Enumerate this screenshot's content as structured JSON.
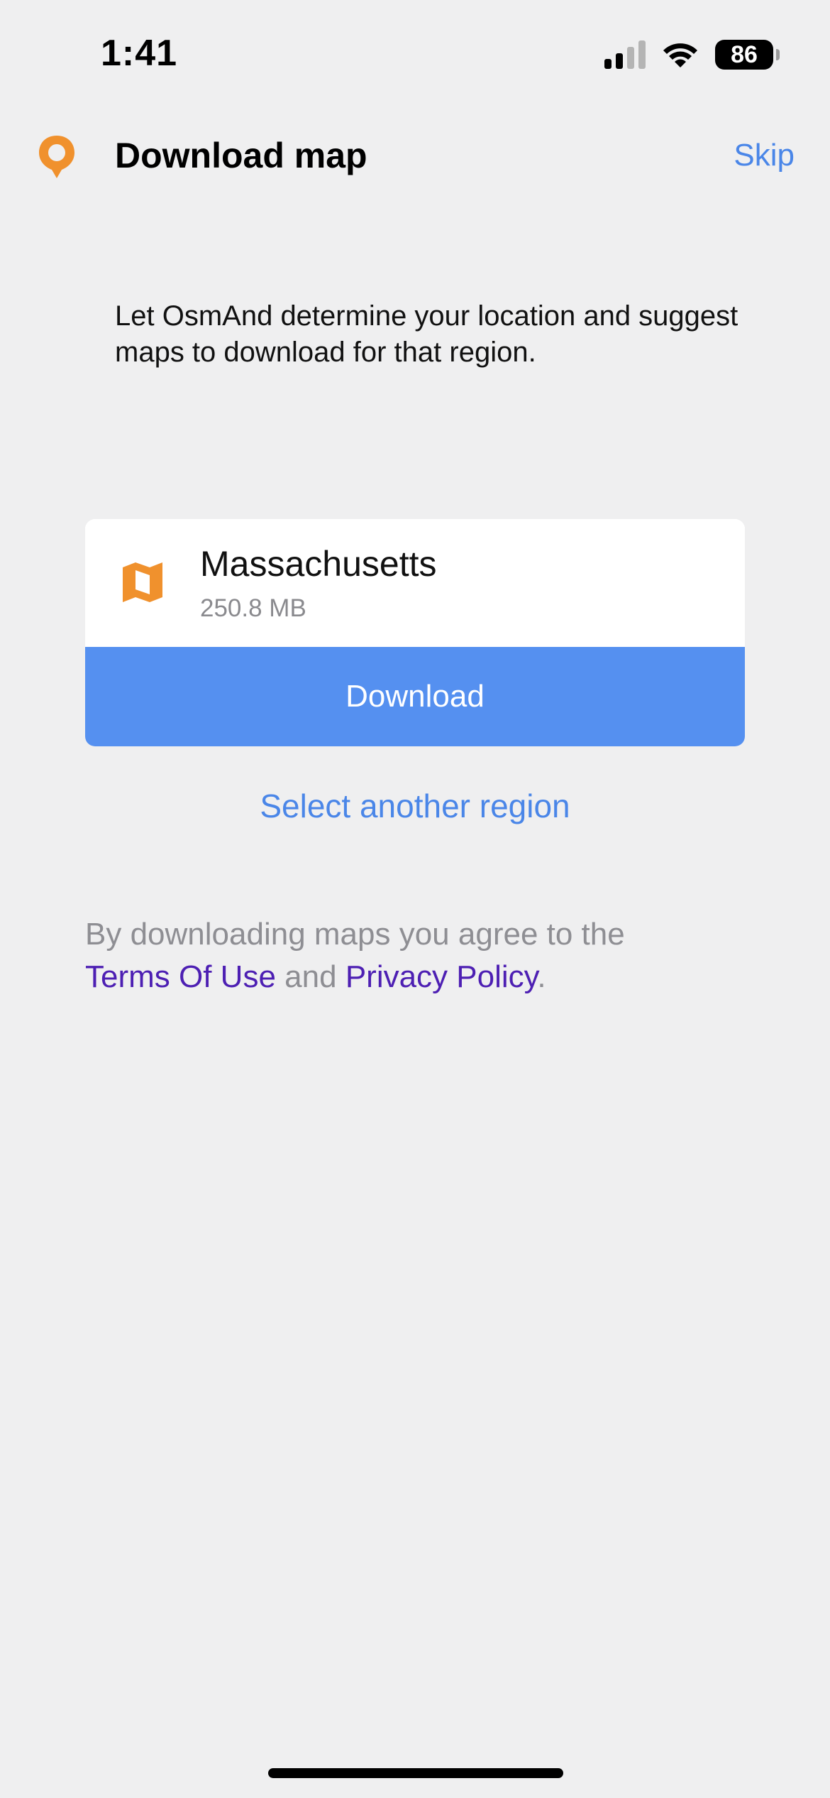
{
  "status_bar": {
    "time": "1:41",
    "battery_level": "86",
    "signal_icon": "cellular-signal-icon",
    "wifi_icon": "wifi-icon"
  },
  "header": {
    "title": "Download map",
    "skip_label": "Skip",
    "logo_icon": "location-pin-icon"
  },
  "description": "Let OsmAnd determine your location and suggest maps to download for that region.",
  "region": {
    "name": "Massachusetts",
    "size": "250.8 MB",
    "icon": "folded-map-icon",
    "download_label": "Download"
  },
  "select_region_label": "Select another region",
  "legal": {
    "prefix": "By downloading maps you agree to the",
    "terms_label": "Terms Of Use",
    "conjunction": "and",
    "privacy_label": "Privacy Policy",
    "suffix": "."
  },
  "colors": {
    "background": "#efeff0",
    "accent": "#4a86e8",
    "button": "#5590f0",
    "brand_orange": "#f0912d",
    "legal_link": "#4d1fb3"
  }
}
